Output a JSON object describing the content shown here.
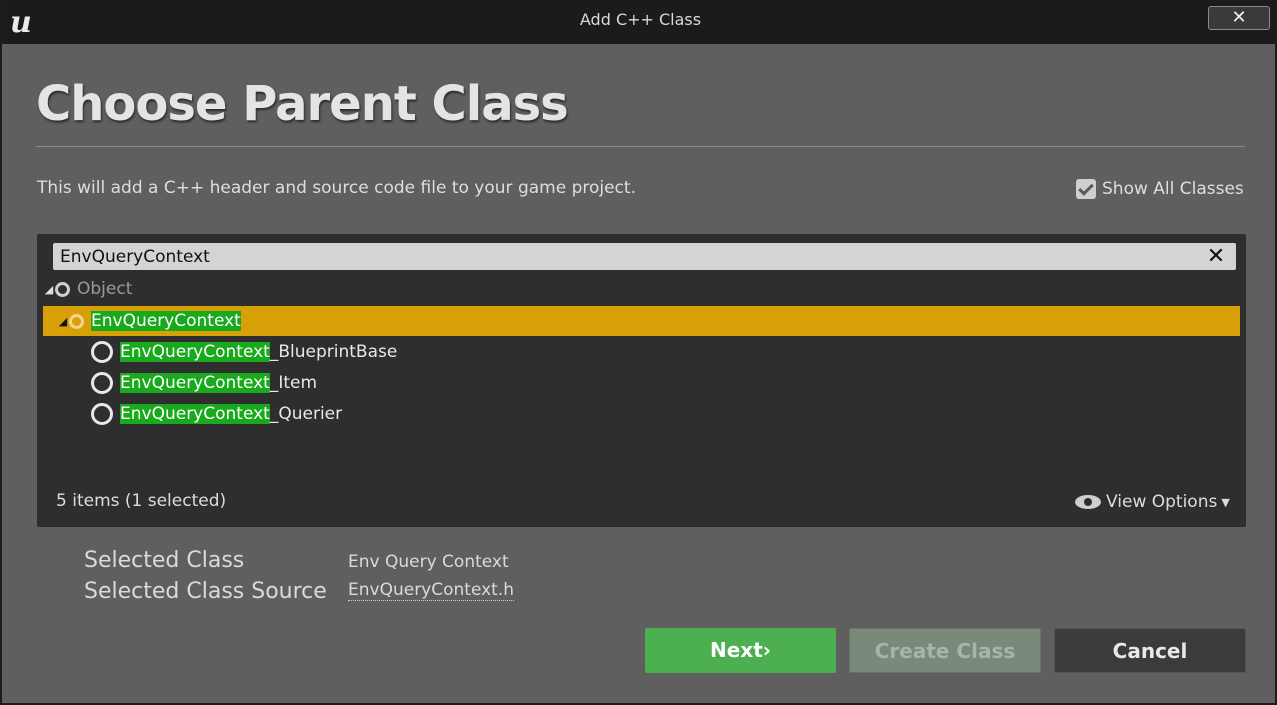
{
  "window": {
    "title": "Add C++ Class",
    "logo_text": "u",
    "close_label": "✕"
  },
  "header": {
    "title": "Choose Parent Class",
    "description": "This will add a C++ header and source code file to your game project."
  },
  "show_all_classes": {
    "label": "Show All Classes",
    "checked": true
  },
  "search": {
    "value": "EnvQueryContext",
    "clear_label": "✕"
  },
  "tree": {
    "items": [
      {
        "highlight": "",
        "rest": "Object",
        "expanded": true,
        "selected": false,
        "dim": true
      },
      {
        "highlight": "EnvQueryContext",
        "rest": "",
        "expanded": true,
        "selected": true,
        "dim": false
      },
      {
        "highlight": "EnvQueryContext",
        "rest": "_BlueprintBase",
        "expanded": false,
        "selected": false,
        "dim": false
      },
      {
        "highlight": "EnvQueryContext",
        "rest": "_Item",
        "expanded": false,
        "selected": false,
        "dim": false
      },
      {
        "highlight": "EnvQueryContext",
        "rest": "_Querier",
        "expanded": false,
        "selected": false,
        "dim": false
      }
    ]
  },
  "footer": {
    "item_count": "5 items (1 selected)",
    "view_options": "View Options"
  },
  "selected_class": {
    "label": "Selected Class",
    "value": "Env Query Context"
  },
  "selected_source": {
    "label": "Selected Class Source",
    "value": "EnvQueryContext.h"
  },
  "buttons": {
    "next": "Next",
    "next_suffix": "›",
    "create": "Create Class",
    "cancel": "Cancel"
  },
  "colors": {
    "selection": "#d99f07",
    "highlight": "#18a91c",
    "next_button": "#4caf50"
  }
}
